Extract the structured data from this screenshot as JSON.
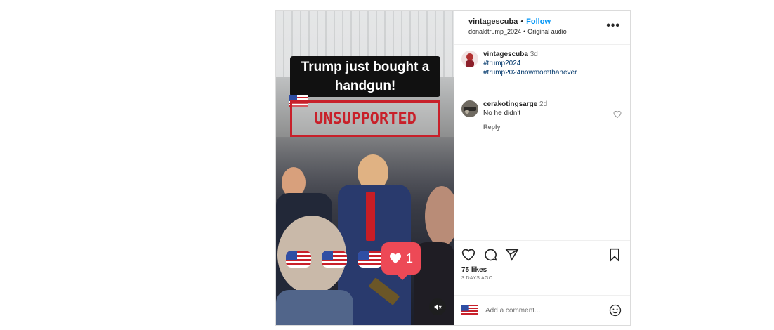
{
  "post": {
    "username": "vintagescuba",
    "follow_label": "Follow",
    "separator": "•",
    "audio_user": "donaldtrump_2024",
    "audio_label": "Original audio",
    "more_label": "•••"
  },
  "media": {
    "caption_line1": "Trump just bought a",
    "caption_line2": "handgun!",
    "stamp_text": "UNSUPPORTED",
    "like_count": "1"
  },
  "caption_comment": {
    "username": "vintagescuba",
    "time": "3d",
    "tags": [
      "#trump2024",
      "#trump2024nowmorethanever"
    ]
  },
  "comment": {
    "username": "cerakotingsarge",
    "time": "2d",
    "text": "No he didn't",
    "reply_label": "Reply"
  },
  "actions": {
    "likes_text": "75 likes",
    "time_ago": "3 DAYS AGO",
    "add_comment_placeholder": "Add a comment..."
  },
  "colors": {
    "accent": "#0095f6",
    "stamp": "#c8202a",
    "like_bubble": "#ed4956"
  },
  "icons": [
    "heart-icon",
    "comment-icon",
    "share-icon",
    "bookmark-icon",
    "emoji-icon",
    "more-icon",
    "mute-icon"
  ]
}
